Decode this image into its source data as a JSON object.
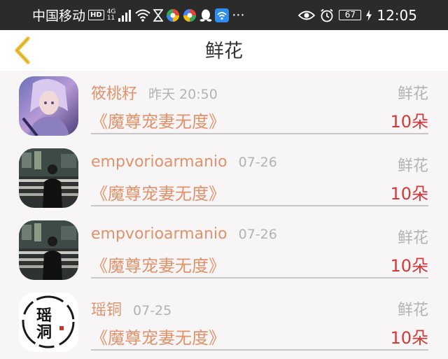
{
  "status_bar": {
    "carrier": "中国移动",
    "hd_badge": "HD",
    "network_top": "4G",
    "network_bottom": "11",
    "battery": "67",
    "time": "12:05",
    "icons": [
      "signal-icon",
      "wifi-icon",
      "hourglass-icon",
      "app-icon-1",
      "app-icon-2",
      "qq-icon",
      "wifi-app-icon",
      "more-dots-icon",
      "eye-icon",
      "alarm-icon",
      "charging-icon"
    ],
    "more": "···"
  },
  "header": {
    "title": "鲜花",
    "back_icon": "chevron-left-icon",
    "accent": "#f2c53d"
  },
  "colors": {
    "name": "#e1926a",
    "amount": "#d23a3a",
    "muted": "#b3b3b3"
  },
  "items": [
    {
      "avatar": "anime-character-avatar",
      "username": "筱桃籽",
      "date": "昨天 20:50",
      "gift_type": "鲜花",
      "book": "《魔尊宠妻无度》",
      "amount": "10朵"
    },
    {
      "avatar": "night-street-man-avatar",
      "username": "empvorioarmanio",
      "date": "07-26",
      "gift_type": "鲜花",
      "book": "《魔尊宠妻无度》",
      "amount": "10朵"
    },
    {
      "avatar": "night-street-man-avatar",
      "username": "empvorioarmanio",
      "date": "07-26",
      "gift_type": "鲜花",
      "book": "《魔尊宠妻无度》",
      "amount": "10朵"
    },
    {
      "avatar": "calligraphy-avatar",
      "avatar_text": "瑶洞",
      "username": "瑶铜",
      "date": "07-25",
      "gift_type": "鲜花",
      "book": "《魔尊宠妻无度》",
      "amount": "10朵"
    }
  ]
}
